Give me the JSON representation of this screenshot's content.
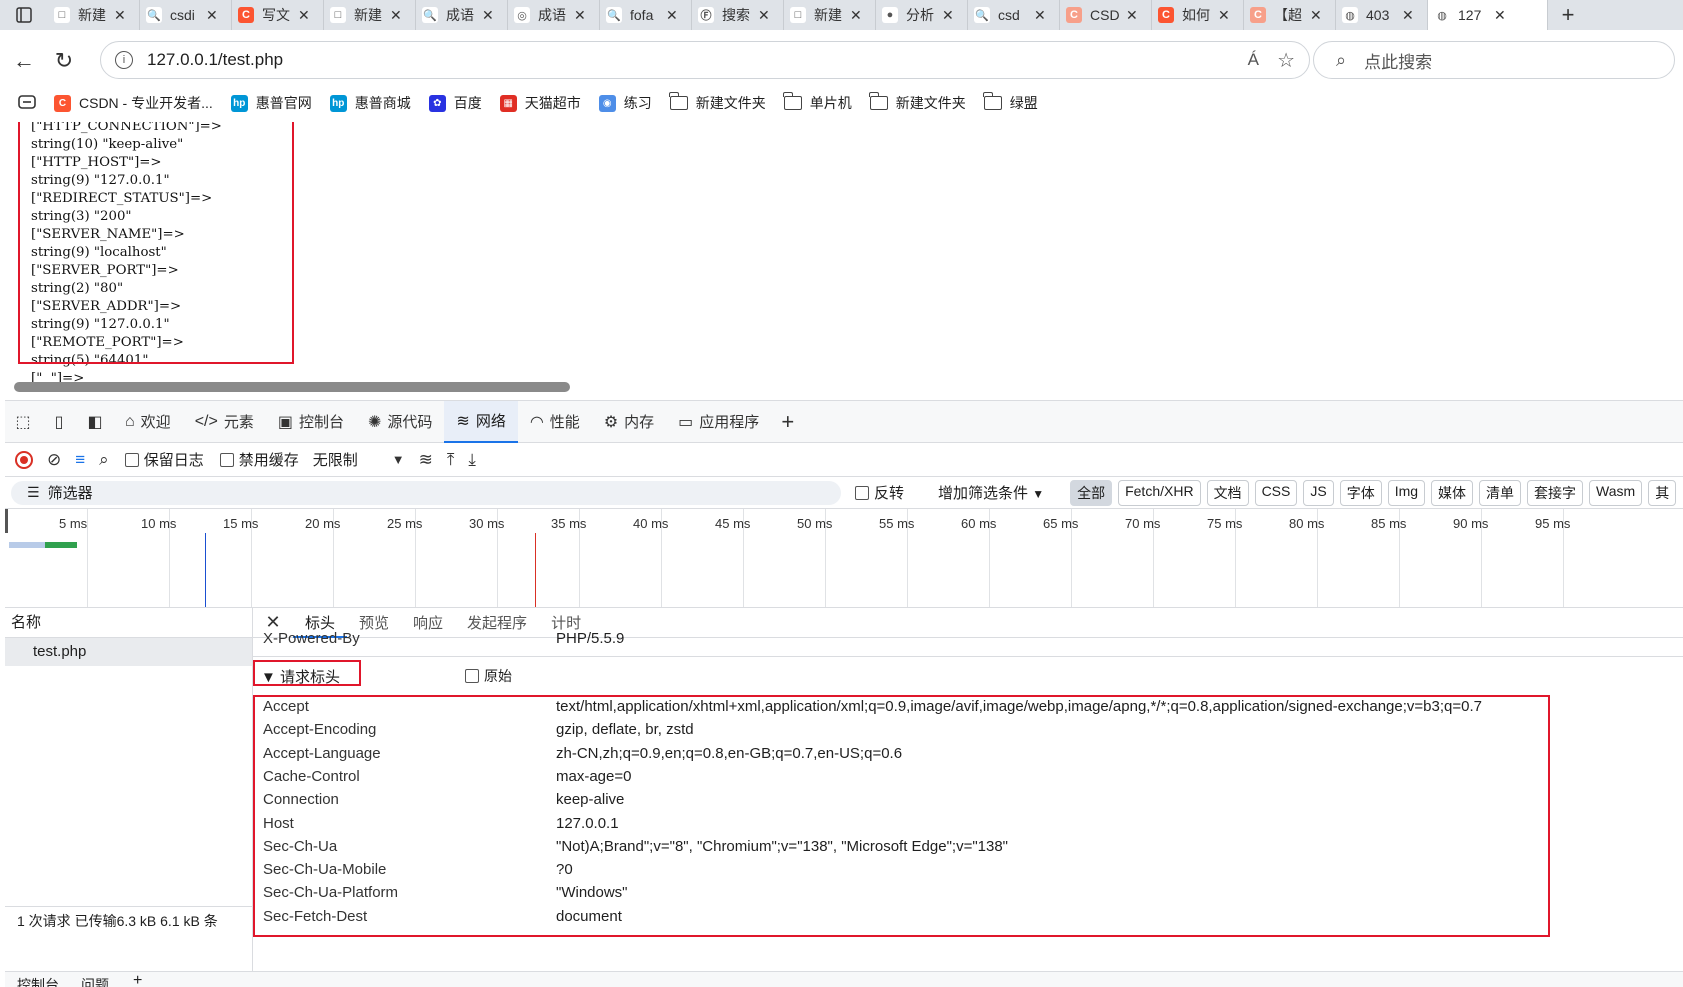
{
  "tabs": [
    {
      "title": "新建",
      "favicon_color": "#ffffff",
      "favicon_glyph": "□",
      "favicon_name": "page-icon"
    },
    {
      "title": "csdi",
      "favicon_color": "#ffffff",
      "favicon_glyph": "🔍",
      "favicon_name": "search-icon"
    },
    {
      "title": "写文",
      "favicon_color": "#fc5531",
      "favicon_glyph": "C",
      "favicon_name": "csdn-icon"
    },
    {
      "title": "新建",
      "favicon_color": "#ffffff",
      "favicon_glyph": "□",
      "favicon_name": "page-icon"
    },
    {
      "title": "成语",
      "favicon_color": "#ffffff",
      "favicon_glyph": "🔍",
      "favicon_name": "search-icon"
    },
    {
      "title": "成语",
      "favicon_color": "#ffffff",
      "favicon_glyph": "◎",
      "favicon_name": "target-icon"
    },
    {
      "title": "fofa",
      "favicon_color": "#ffffff",
      "favicon_glyph": "🔍",
      "favicon_name": "search-icon"
    },
    {
      "title": "搜索",
      "favicon_color": "#ffffff",
      "favicon_glyph": "Ⓕ",
      "favicon_name": "fofa-icon"
    },
    {
      "title": "新建",
      "favicon_color": "#ffffff",
      "favicon_glyph": "□",
      "favicon_name": "page-icon"
    },
    {
      "title": "分析",
      "favicon_color": "#ffffff",
      "favicon_glyph": "●",
      "favicon_name": "avatar-icon"
    },
    {
      "title": "csd",
      "favicon_color": "#ffffff",
      "favicon_glyph": "🔍",
      "favicon_name": "search-icon"
    },
    {
      "title": "CSD",
      "favicon_color": "#f7a08a",
      "favicon_glyph": "C",
      "favicon_name": "csdn-icon"
    },
    {
      "title": "如何",
      "favicon_color": "#fc5531",
      "favicon_glyph": "C",
      "favicon_name": "csdn-icon"
    },
    {
      "title": "【超",
      "favicon_color": "#f7a08a",
      "favicon_glyph": "C",
      "favicon_name": "csdn-icon"
    },
    {
      "title": "403",
      "favicon_color": "#ffffff",
      "favicon_glyph": "◍",
      "favicon_name": "globe-icon"
    },
    {
      "title": "127",
      "favicon_color": "#ffffff",
      "favicon_glyph": "◍",
      "favicon_name": "globe-icon",
      "active": true
    }
  ],
  "address": {
    "url": "127.0.0.1/test.php",
    "search_placeholder": "点此搜索",
    "read_aloud": "Á",
    "favorite": "☆"
  },
  "bookmarks": [
    {
      "label": "",
      "type": "icon",
      "color": "#444444"
    },
    {
      "label": "CSDN - 专业开发者...",
      "type": "fav",
      "color": "#fc5531",
      "glyph": "C"
    },
    {
      "label": "惠普官网",
      "type": "fav",
      "color": "#0096d6",
      "glyph": "hp"
    },
    {
      "label": "惠普商城",
      "type": "fav",
      "color": "#0096d6",
      "glyph": "hp"
    },
    {
      "label": "百度",
      "type": "fav",
      "color": "#2932e1",
      "glyph": "✿"
    },
    {
      "label": "天猫超市",
      "type": "fav",
      "color": "#e02e24",
      "glyph": "▦"
    },
    {
      "label": "练习",
      "type": "fav",
      "color": "#4e8ee8",
      "glyph": "◉"
    },
    {
      "label": "新建文件夹",
      "type": "folder"
    },
    {
      "label": "单片机",
      "type": "folder"
    },
    {
      "label": "新建文件夹",
      "type": "folder"
    },
    {
      "label": "绿盟",
      "type": "folder"
    }
  ],
  "dump_lines": [
    "[\"HTTP_CONNECTION\"]=>",
    "string(10) \"keep-alive\"",
    "[\"HTTP_HOST\"]=>",
    "string(9) \"127.0.0.1\"",
    "[\"REDIRECT_STATUS\"]=>",
    "string(3) \"200\"",
    "[\"SERVER_NAME\"]=>",
    "string(9) \"localhost\"",
    "[\"SERVER_PORT\"]=>",
    "string(2) \"80\"",
    "[\"SERVER_ADDR\"]=>",
    "string(9) \"127.0.0.1\"",
    "[\"REMOTE_PORT\"]=>",
    "string(5) \"64401\"",
    "[\"  \"]=>"
  ],
  "devtools": {
    "tabs": [
      {
        "label": "欢迎",
        "icon": "⌂",
        "icon_name": "home-icon"
      },
      {
        "label": "元素",
        "icon": "</>",
        "icon_name": "code-icon"
      },
      {
        "label": "控制台",
        "icon": "▣",
        "icon_name": "console-icon"
      },
      {
        "label": "源代码",
        "icon": "✺",
        "icon_name": "bug-icon"
      },
      {
        "label": "网络",
        "icon": "≋",
        "icon_name": "wifi-icon",
        "active": true
      },
      {
        "label": "性能",
        "icon": "◠",
        "icon_name": "performance-icon"
      },
      {
        "label": "内存",
        "icon": "⚙",
        "icon_name": "memory-icon"
      },
      {
        "label": "应用程序",
        "icon": "▭",
        "icon_name": "application-icon"
      }
    ],
    "toolbar": {
      "preserve_log": "保留日志",
      "disable_cache": "禁用缓存",
      "throttle": "无限制"
    },
    "filter": {
      "placeholder": "筛选器",
      "invert": "反转",
      "more_filters": "增加筛选条件",
      "chips": [
        "全部",
        "Fetch/XHR",
        "文档",
        "CSS",
        "JS",
        "字体",
        "Img",
        "媒体",
        "清单",
        "套接字",
        "Wasm",
        "其"
      ]
    },
    "timeline_ticks": [
      "5 ms",
      "10 ms",
      "15 ms",
      "20 ms",
      "25 ms",
      "30 ms",
      "35 ms",
      "40 ms",
      "45 ms",
      "50 ms",
      "55 ms",
      "60 ms",
      "65 ms",
      "70 ms",
      "75 ms",
      "80 ms",
      "85 ms",
      "90 ms",
      "95 ms"
    ],
    "requests": {
      "column_name": "名称",
      "items": [
        "test.php"
      ],
      "summary": "1 次请求  已传输6.3 kB  6.1 kB 条"
    },
    "detail_tabs": [
      "标头",
      "预览",
      "响应",
      "发起程序",
      "计时"
    ],
    "response_partial": {
      "name": "X-Powered-By",
      "value": "PHP/5.5.9"
    },
    "request_headers_title": "▼ 请求标头",
    "raw_label": "原始",
    "request_headers": [
      {
        "name": "Accept",
        "value": "text/html,application/xhtml+xml,application/xml;q=0.9,image/avif,image/webp,image/apng,*/*;q=0.8,application/signed-exchange;v=b3;q=0.7"
      },
      {
        "name": "Accept-Encoding",
        "value": "gzip, deflate, br, zstd"
      },
      {
        "name": "Accept-Language",
        "value": "zh-CN,zh;q=0.9,en;q=0.8,en-GB;q=0.7,en-US;q=0.6"
      },
      {
        "name": "Cache-Control",
        "value": "max-age=0"
      },
      {
        "name": "Connection",
        "value": "keep-alive"
      },
      {
        "name": "Host",
        "value": "127.0.0.1"
      },
      {
        "name": "Sec-Ch-Ua",
        "value": "\"Not)A;Brand\";v=\"8\", \"Chromium\";v=\"138\", \"Microsoft Edge\";v=\"138\""
      },
      {
        "name": "Sec-Ch-Ua-Mobile",
        "value": "?0"
      },
      {
        "name": "Sec-Ch-Ua-Platform",
        "value": "\"Windows\""
      },
      {
        "name": "Sec-Fetch-Dest",
        "value": "document"
      }
    ],
    "drawer_tabs": [
      "控制台",
      "问题"
    ]
  },
  "colors": {
    "highlight": "#e0162b",
    "accent": "#1a73e8",
    "timeline_red": "#d93025",
    "timeline_blue": "#1a4fd1"
  }
}
